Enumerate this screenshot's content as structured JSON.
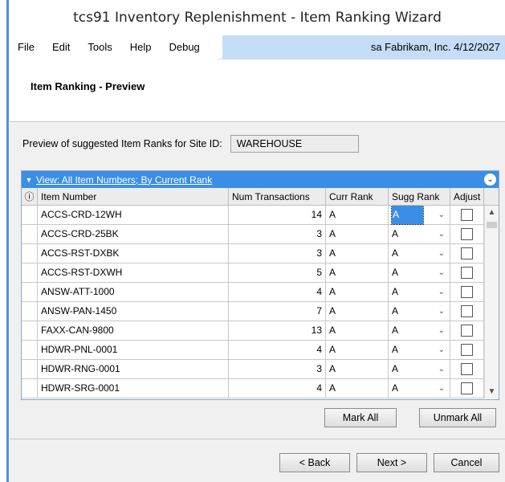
{
  "window": {
    "title": "tcs91 Inventory Replenishment - Item Ranking Wizard"
  },
  "menu": {
    "items": [
      "File",
      "Edit",
      "Tools",
      "Help",
      "Debug"
    ],
    "user_info": "sa  Fabrikam, Inc.  4/12/2027"
  },
  "header": {
    "title": "Item Ranking - Preview"
  },
  "site": {
    "label": "Preview of suggested Item Ranks for Site ID:",
    "value": "WAREHOUSE"
  },
  "grid": {
    "view_label": "View: All Item Numbers; By Current Rank",
    "columns": {
      "info": "ⓘ",
      "item_number": "Item Number",
      "num_transactions": "Num Transactions",
      "curr_rank": "Curr Rank",
      "sugg_rank": "Sugg Rank",
      "adjust": "Adjust"
    },
    "rows": [
      {
        "item": "ACCS-CRD-12WH",
        "num": "14",
        "curr": "A",
        "sugg": "A",
        "selected": true
      },
      {
        "item": "ACCS-CRD-25BK",
        "num": "3",
        "curr": "A",
        "sugg": "A"
      },
      {
        "item": "ACCS-RST-DXBK",
        "num": "3",
        "curr": "A",
        "sugg": "A"
      },
      {
        "item": "ACCS-RST-DXWH",
        "num": "5",
        "curr": "A",
        "sugg": "A"
      },
      {
        "item": "ANSW-ATT-1000",
        "num": "4",
        "curr": "A",
        "sugg": "A"
      },
      {
        "item": "ANSW-PAN-1450",
        "num": "7",
        "curr": "A",
        "sugg": "A"
      },
      {
        "item": "FAXX-CAN-9800",
        "num": "13",
        "curr": "A",
        "sugg": "A"
      },
      {
        "item": "HDWR-PNL-0001",
        "num": "4",
        "curr": "A",
        "sugg": "A"
      },
      {
        "item": "HDWR-RNG-0001",
        "num": "3",
        "curr": "A",
        "sugg": "A"
      },
      {
        "item": "HDWR-SRG-0001",
        "num": "4",
        "curr": "A",
        "sugg": "A"
      }
    ]
  },
  "buttons": {
    "mark_all": "Mark All",
    "unmark_all": "Unmark All",
    "back": "< Back",
    "next": "Next >",
    "cancel": "Cancel"
  },
  "colors": {
    "grid_header": "#3a8ee6",
    "menu_info_bg": "#c5ddf7"
  }
}
